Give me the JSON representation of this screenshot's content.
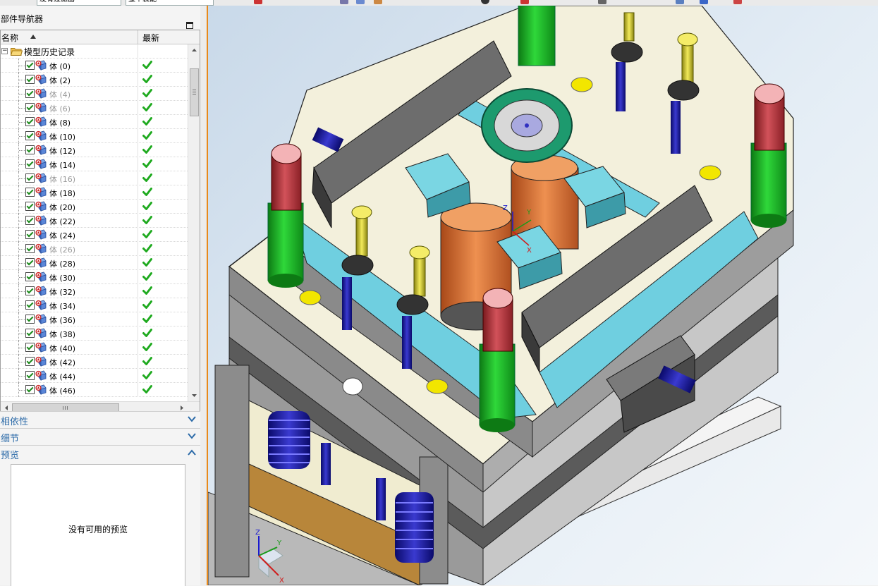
{
  "toolbar": {
    "field_1": "发有过滤器",
    "field_2": "整个装配"
  },
  "navigator": {
    "title": "部件导航器",
    "columns": {
      "name": "名称",
      "latest": "最新"
    },
    "root": {
      "label": "模型历史记录"
    },
    "items": [
      {
        "label": "体 (0)",
        "dim": false
      },
      {
        "label": "体 (2)",
        "dim": false
      },
      {
        "label": "体 (4)",
        "dim": true
      },
      {
        "label": "体 (6)",
        "dim": true
      },
      {
        "label": "体 (8)",
        "dim": false
      },
      {
        "label": "体 (10)",
        "dim": false
      },
      {
        "label": "体 (12)",
        "dim": false
      },
      {
        "label": "体 (14)",
        "dim": false
      },
      {
        "label": "体 (16)",
        "dim": true
      },
      {
        "label": "体 (18)",
        "dim": false
      },
      {
        "label": "体 (20)",
        "dim": false
      },
      {
        "label": "体 (22)",
        "dim": false
      },
      {
        "label": "体 (24)",
        "dim": false
      },
      {
        "label": "体 (26)",
        "dim": true
      },
      {
        "label": "体 (28)",
        "dim": false
      },
      {
        "label": "体 (30)",
        "dim": false
      },
      {
        "label": "体 (32)",
        "dim": false
      },
      {
        "label": "体 (34)",
        "dim": false
      },
      {
        "label": "体 (36)",
        "dim": false
      },
      {
        "label": "体 (38)",
        "dim": false
      },
      {
        "label": "体 (40)",
        "dim": false
      },
      {
        "label": "体 (42)",
        "dim": false
      },
      {
        "label": "体 (44)",
        "dim": false
      },
      {
        "label": "体 (46)",
        "dim": false
      }
    ]
  },
  "sections": {
    "dependency": "相依性",
    "details": "细节",
    "preview": "预览",
    "preview_empty": "没有可用的预览"
  },
  "viewport": {
    "csys_labels": {
      "x": "X",
      "y": "Y",
      "z": "Z"
    },
    "triad_labels": {
      "x": "X",
      "y": "Y",
      "z": "Z"
    }
  },
  "colors": {
    "plate": "#f3f0dc",
    "plate_side": "#7a7a7a",
    "guide_pillar": "#1fbf2a",
    "return_pin": "#b3363c",
    "screw": "#d8d02a",
    "ejector": "#1a1a9e",
    "cavity": "#e07a38",
    "slider_block": "#66c9d6",
    "accent": "#e8891a"
  }
}
